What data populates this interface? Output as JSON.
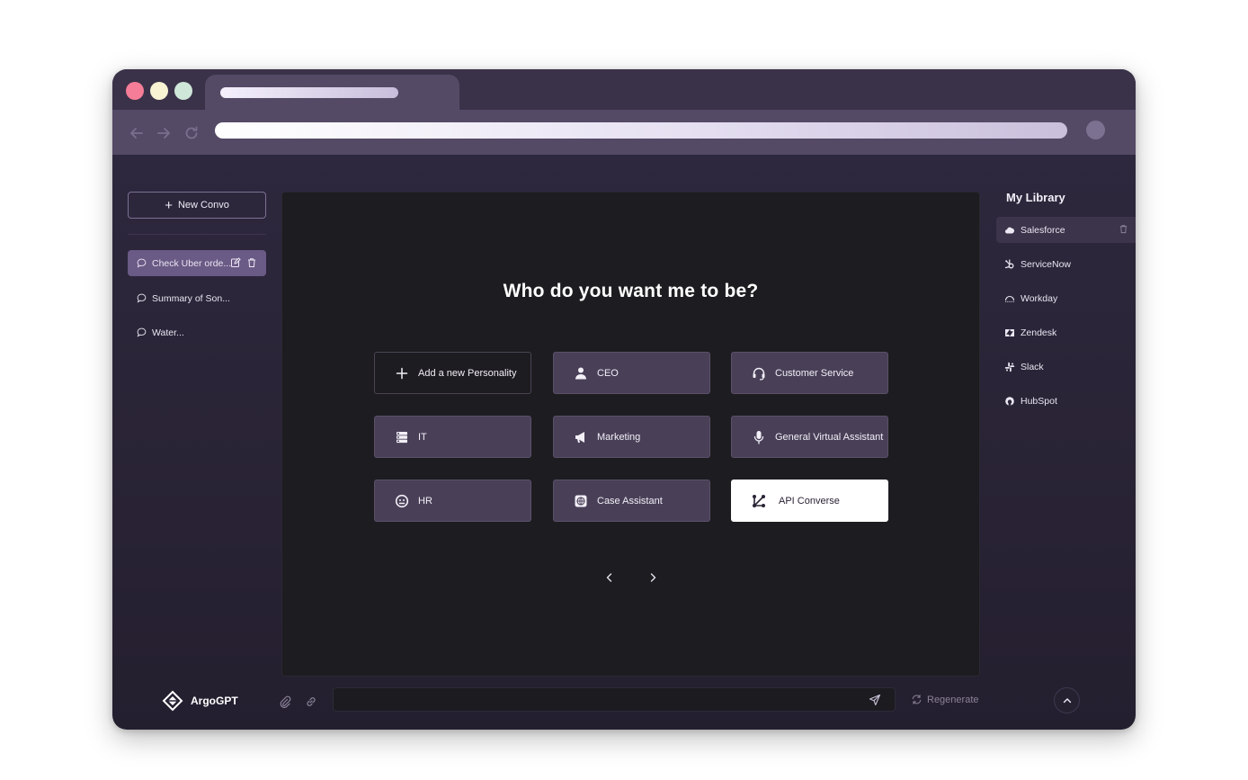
{
  "app": {
    "name": "ArgoGPT"
  },
  "sidebar": {
    "new_convo_label": "New Convo",
    "conversations": [
      {
        "label": "Check Uber orde...",
        "active": true
      },
      {
        "label": "Summary of Son...",
        "active": false
      },
      {
        "label": "Water...",
        "active": false
      }
    ]
  },
  "main": {
    "title": "Who do you want me to be?",
    "personalities": [
      {
        "label": "Add a new Personality",
        "icon": "plus-icon"
      },
      {
        "label": "CEO",
        "icon": "person-icon"
      },
      {
        "label": "Customer Service",
        "icon": "headset-icon"
      },
      {
        "label": "IT",
        "icon": "server-icon"
      },
      {
        "label": "Marketing",
        "icon": "megaphone-icon"
      },
      {
        "label": "General Virtual Assistant",
        "icon": "microphone-icon"
      },
      {
        "label": "HR",
        "icon": "smile-icon"
      },
      {
        "label": "Case Assistant",
        "icon": "globe-icon"
      },
      {
        "label": "API Converse",
        "icon": "api-icon",
        "selected": true
      }
    ]
  },
  "library": {
    "title": "My Library",
    "items": [
      {
        "label": "Salesforce",
        "icon": "salesforce-icon",
        "active": true
      },
      {
        "label": "ServiceNow",
        "icon": "hubspot-style-icon"
      },
      {
        "label": "Workday",
        "icon": "workday-icon"
      },
      {
        "label": "Zendesk",
        "icon": "zendesk-icon"
      },
      {
        "label": "Slack",
        "icon": "slack-icon"
      },
      {
        "label": "HubSpot",
        "icon": "hubspot-icon"
      }
    ]
  },
  "bottom": {
    "input_value": "",
    "regenerate_label": "Regenerate"
  },
  "colors": {
    "window_bg": "#2a2437",
    "accent": "#6a5a86",
    "card": "#494058",
    "panel": "#1d1c20"
  }
}
